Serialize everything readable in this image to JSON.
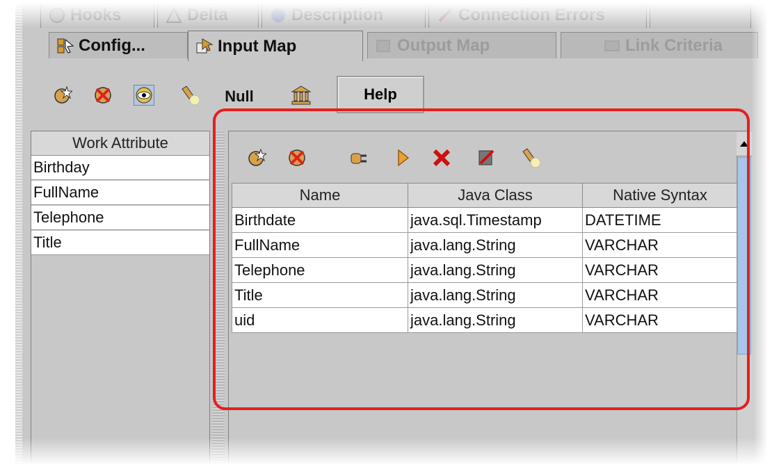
{
  "tabs_top": [
    "Hooks",
    "Delta",
    "Description",
    "Connection Errors"
  ],
  "tabs": [
    {
      "label": "Config...",
      "active": false,
      "dimmed": false
    },
    {
      "label": "Input Map",
      "active": true,
      "dimmed": false
    },
    {
      "label": "Output Map",
      "active": false,
      "dimmed": true
    },
    {
      "label": "Link Criteria",
      "active": false,
      "dimmed": true
    }
  ],
  "toolbar": {
    "icons": [
      "new-icon",
      "delete-icon",
      "view-icon",
      "flashlight-icon"
    ],
    "null_label": "Null",
    "help_label": "Help"
  },
  "work_attributes": {
    "header": "Work Attribute",
    "items": [
      "Birthday",
      "FullName",
      "Telephone",
      "Title"
    ]
  },
  "schema": {
    "toolbar_icons": [
      "new-icon",
      "delete-icon",
      "plug-icon",
      "play-icon",
      "remove-icon",
      "edit-icon",
      "flashlight-icon"
    ],
    "columns": [
      "Name",
      "Java Class",
      "Native Syntax"
    ],
    "rows": [
      [
        "Birthdate",
        "java.sql.Timestamp",
        "DATETIME"
      ],
      [
        "FullName",
        "java.lang.String",
        "VARCHAR"
      ],
      [
        "Telephone",
        "java.lang.String",
        "VARCHAR"
      ],
      [
        "Title",
        "java.lang.String",
        "VARCHAR"
      ],
      [
        "uid",
        "java.lang.String",
        "VARCHAR"
      ]
    ]
  },
  "colors": {
    "highlight": "#e41f1f",
    "scroll_thumb": "#a8c6ec",
    "panel": "#c8c8c8"
  }
}
